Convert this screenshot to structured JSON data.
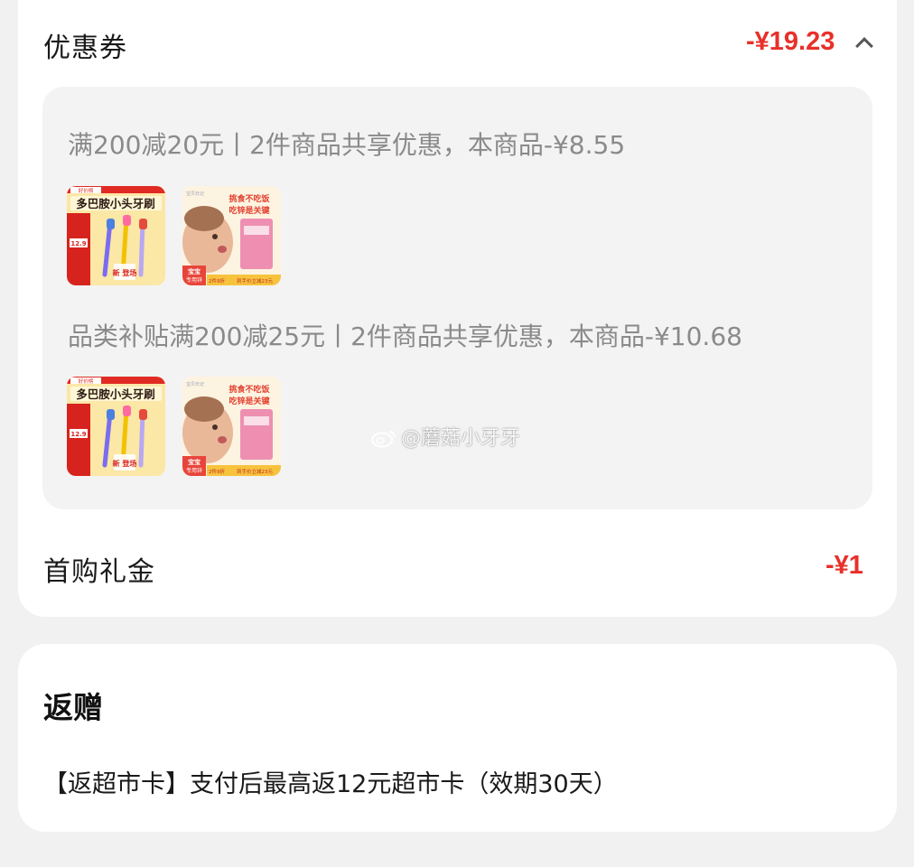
{
  "coupon": {
    "label": "优惠券",
    "amount": "-¥19.23",
    "promos": [
      {
        "text": "满200减20元丨2件商品共享优惠，本商品-¥8.55"
      },
      {
        "text": "品类补贴满200减25元丨2件商品共享优惠，本商品-¥10.68"
      }
    ],
    "product_toothbrush": {
      "top_tag": "好价榜",
      "title": "多巴胺小头牙刷",
      "price": "12.9",
      "stamp": "新 登场"
    },
    "product_zinc": {
      "brand": "宝贝日记",
      "headline1": "挑食不吃饭",
      "headline2": "吃锌是关键",
      "badge_a": "宝宝",
      "badge_b": "专用锌",
      "promo_a": "2件9折",
      "promo_b": "到手价立减23元"
    }
  },
  "first_purchase": {
    "label": "首购礼金",
    "amount": "-¥1"
  },
  "watermark": "@蘑菇小牙牙",
  "gift": {
    "title": "返赠",
    "text": "【返超市卡】支付后最高返12元超市卡（效期30天）"
  },
  "colors": {
    "accent_red": "#e8302a",
    "muted_text": "#8a8a8a",
    "box_bg": "#f3f3f3"
  }
}
